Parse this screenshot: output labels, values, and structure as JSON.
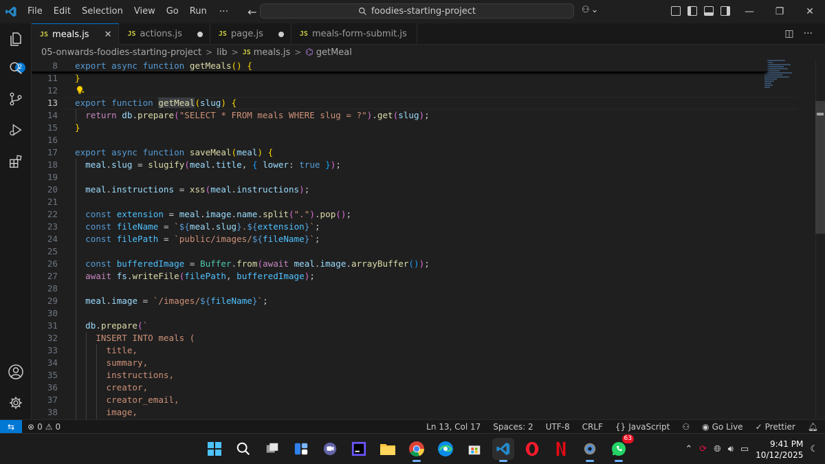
{
  "titlebar": {
    "menu": [
      "File",
      "Edit",
      "Selection",
      "View",
      "Go",
      "Run"
    ],
    "more": "···",
    "search": "foodies-starting-project"
  },
  "activity": {
    "explorer_badge": "2"
  },
  "tabs": [
    {
      "label": "meals.js",
      "icon": "JS",
      "state": "active-close"
    },
    {
      "label": "actions.js",
      "icon": "JS",
      "state": "modified"
    },
    {
      "label": "page.js",
      "icon": "JS",
      "state": "modified"
    },
    {
      "label": "meals-form-submit.js",
      "icon": "JS",
      "state": "clean"
    }
  ],
  "breadcrumb": {
    "folder": "05-onwards-foodies-starting-project",
    "subfolder": "lib",
    "file_icon": "JS",
    "file": "meals.js",
    "symbol": "getMeal"
  },
  "editor": {
    "current_line": 13,
    "lines": [
      {
        "n": "8",
        "html": "<span class=\"kw\">export</span> <span class=\"kw\">async</span> <span class=\"kw\">function</span> <span class=\"fn\">getMeals</span><span class=\"b1\">()</span> <span class=\"b1\">{</span>"
      },
      {
        "n": "11",
        "html": "<span class=\"b1\">}</span>"
      },
      {
        "n": "12",
        "html": ""
      },
      {
        "n": "13",
        "html": "<span class=\"kw\">export</span> <span class=\"kw\">function</span> <span class=\"fn hl\">getMeal</span><span class=\"b1\">(</span><span class=\"var\">slug</span><span class=\"b1\">)</span> <span class=\"b1\">{</span>"
      },
      {
        "n": "14",
        "html": "  <span class=\"ctl\">return</span> <span class=\"var\">db</span>.<span class=\"fn\">prepare</span><span class=\"b2\">(</span><span class=\"str\">\"SELECT * FROM meals WHERE slug = ?\"</span><span class=\"b2\">)</span>.<span class=\"fn\">get</span><span class=\"b2\">(</span><span class=\"var\">slug</span><span class=\"b2\">)</span>;"
      },
      {
        "n": "15",
        "html": "<span class=\"b1\">}</span>"
      },
      {
        "n": "16",
        "html": ""
      },
      {
        "n": "17",
        "html": "<span class=\"kw\">export</span> <span class=\"kw\">async</span> <span class=\"kw\">function</span> <span class=\"fn\">saveMeal</span><span class=\"b1\">(</span><span class=\"var\">meal</span><span class=\"b1\">)</span> <span class=\"b1\">{</span>"
      },
      {
        "n": "18",
        "html": "  <span class=\"var\">meal</span>.<span class=\"var\">slug</span> = <span class=\"fn\">slugify</span><span class=\"b2\">(</span><span class=\"var\">meal</span>.<span class=\"var\">title</span>, <span class=\"b3\">{</span> <span class=\"var\">lower</span>: <span class=\"kw\">true</span> <span class=\"b3\">}</span><span class=\"b2\">)</span>;"
      },
      {
        "n": "19",
        "html": ""
      },
      {
        "n": "20",
        "html": "  <span class=\"var\">meal</span>.<span class=\"var\">instructions</span> = <span class=\"fn\">xss</span><span class=\"b2\">(</span><span class=\"var\">meal</span>.<span class=\"var\">instructions</span><span class=\"b2\">)</span>;"
      },
      {
        "n": "21",
        "html": ""
      },
      {
        "n": "22",
        "html": "  <span class=\"kw\">const</span> <span class=\"cst\">extension</span> = <span class=\"var\">meal</span>.<span class=\"var\">image</span>.<span class=\"var\">name</span>.<span class=\"fn\">split</span><span class=\"b2\">(</span><span class=\"str\">\".\"</span><span class=\"b2\">)</span>.<span class=\"fn\">pop</span><span class=\"b2\">()</span>;"
      },
      {
        "n": "23",
        "html": "  <span class=\"kw\">const</span> <span class=\"cst\">fileName</span> = <span class=\"str\">`</span><span class=\"tpl\">${</span><span class=\"var\">meal</span>.<span class=\"var\">slug</span><span class=\"tpl\">}</span><span class=\"str\">.</span><span class=\"tpl\">${</span><span class=\"cst\">extension</span><span class=\"tpl\">}</span><span class=\"str\">`</span>;"
      },
      {
        "n": "24",
        "html": "  <span class=\"kw\">const</span> <span class=\"cst\">filePath</span> = <span class=\"str\">`public/images/</span><span class=\"tpl\">${</span><span class=\"cst\">fileName</span><span class=\"tpl\">}</span><span class=\"str\">`</span>;"
      },
      {
        "n": "25",
        "html": ""
      },
      {
        "n": "26",
        "html": "  <span class=\"kw\">const</span> <span class=\"cst\">bufferedImage</span> = <span class=\"cls\">Buffer</span>.<span class=\"fn\">from</span><span class=\"b2\">(</span><span class=\"ctl\">await</span> <span class=\"var\">meal</span>.<span class=\"var\">image</span>.<span class=\"fn\">arrayBuffer</span><span class=\"b3\">()</span><span class=\"b2\">)</span>;"
      },
      {
        "n": "27",
        "html": "  <span class=\"ctl\">await</span> <span class=\"var\">fs</span>.<span class=\"fn\">writeFile</span><span class=\"b2\">(</span><span class=\"cst\">filePath</span>, <span class=\"cst\">bufferedImage</span><span class=\"b2\">)</span>;"
      },
      {
        "n": "28",
        "html": ""
      },
      {
        "n": "29",
        "html": "  <span class=\"var\">meal</span>.<span class=\"var\">image</span> = <span class=\"str\">`/images/</span><span class=\"tpl\">${</span><span class=\"cst\">fileName</span><span class=\"tpl\">}</span><span class=\"str\">`</span>;"
      },
      {
        "n": "30",
        "html": ""
      },
      {
        "n": "31",
        "html": "  <span class=\"var\">db</span>.<span class=\"fn\">prepare</span><span class=\"b2\">(</span><span class=\"str\">`</span>"
      },
      {
        "n": "32",
        "html": "<span class=\"str\">    INSERT INTO meals (</span>"
      },
      {
        "n": "33",
        "html": "<span class=\"str\">      title,</span>"
      },
      {
        "n": "34",
        "html": "<span class=\"str\">      summary,</span>"
      },
      {
        "n": "35",
        "html": "<span class=\"str\">      instructions,</span>"
      },
      {
        "n": "36",
        "html": "<span class=\"str\">      creator,</span>"
      },
      {
        "n": "37",
        "html": "<span class=\"str\">      creator_email,</span>"
      },
      {
        "n": "38",
        "html": "<span class=\"str\">      image,</span>"
      }
    ]
  },
  "statusbar": {
    "errors": "0",
    "warnings": "0",
    "position": "Ln 13, Col 17",
    "spaces": "Spaces: 2",
    "encoding": "UTF-8",
    "eol": "CRLF",
    "language": "JavaScript",
    "golive": "Go Live",
    "prettier": "Prettier"
  },
  "taskbar": {
    "whatsapp_badge": "63",
    "time": "9:41 PM",
    "date": "10/12/2025"
  },
  "colors": {
    "accent": "#0078d4",
    "editor_bg": "#1f1f1f",
    "keyword": "#569cd6",
    "function": "#dcdcaa",
    "string": "#ce9178"
  }
}
